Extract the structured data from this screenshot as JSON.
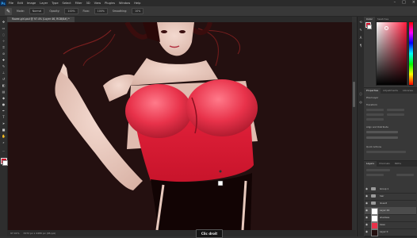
{
  "menubar": {
    "logo": "Ps",
    "items": [
      "File",
      "Edit",
      "Image",
      "Layer",
      "Type",
      "Select",
      "Filter",
      "3D",
      "View",
      "Plugins",
      "Window",
      "Help"
    ],
    "window_buttons": [
      "–",
      "□",
      "×"
    ]
  },
  "options_bar": {
    "mode_label": "Mode:",
    "mode_value": "Normal",
    "opacity_label": "Opacity:",
    "opacity_value": "100%",
    "flow_label": "Flow:",
    "flow_value": "100%",
    "smoothing_label": "Smoothing:",
    "smoothing_value": "10%"
  },
  "document_tab": {
    "title": "flower-girl.psd @ 97.4% (Layer 46, RGB/8#) *"
  },
  "status_bar": {
    "zoom": "97.41%",
    "doc_info": "3472 px x 2480 px (96 ppi)"
  },
  "tooltip": {
    "text": "Clic droit"
  },
  "colors": {
    "foreground": "#d4102b",
    "background": "#ffffff",
    "canvas_bg": "#241010"
  },
  "panels": {
    "color_tabs": [
      "Color",
      "Swatches"
    ],
    "properties_tabs": [
      "Properties",
      "Adjustments",
      "Libraries"
    ],
    "properties_labels": [
      "Pixel Layer",
      "Transform",
      "Align and Distribute",
      "Quick Actions"
    ],
    "layers_tabs": [
      "Layers",
      "Channels",
      "Paths"
    ],
    "layers": [
      {
        "name": "Group 1",
        "kind": "group"
      },
      {
        "name": "hair",
        "kind": "group"
      },
      {
        "name": "lineart",
        "kind": "group"
      },
      {
        "name": "Layer 46",
        "kind": "layer"
      },
      {
        "name": "shadows",
        "kind": "layer"
      },
      {
        "name": "base",
        "kind": "layer"
      },
      {
        "name": "Layer 0",
        "kind": "layer"
      }
    ]
  }
}
